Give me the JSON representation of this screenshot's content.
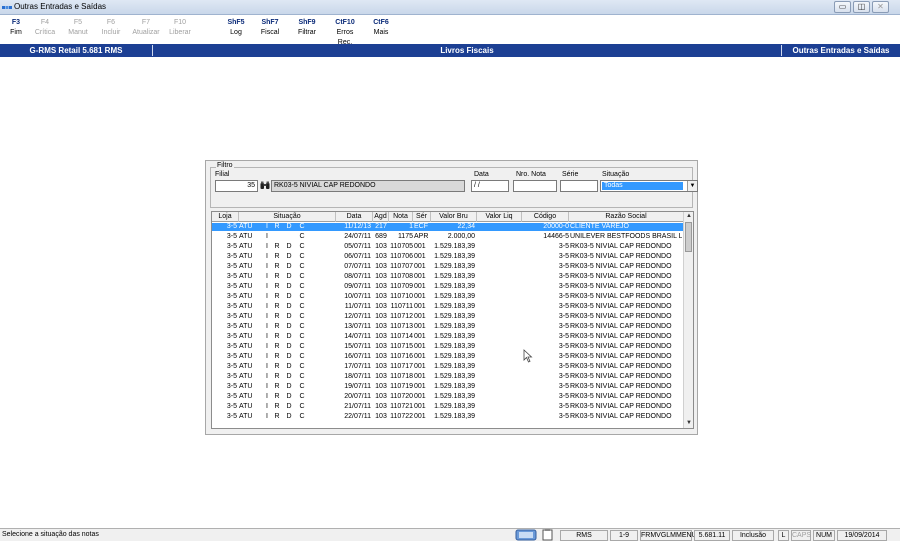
{
  "window": {
    "title": "Outras Entradas e Saídas",
    "buttons": [
      "▭",
      "◫",
      "✕"
    ]
  },
  "toolbar": {
    "keys": [
      {
        "key": "F3",
        "label": "Fim",
        "enabled": true
      },
      {
        "key": "F4",
        "label": "Crítica",
        "enabled": false
      },
      {
        "key": "F5",
        "label": "Manut",
        "enabled": false
      },
      {
        "key": "F6",
        "label": "Incluir",
        "enabled": false
      },
      {
        "key": "F7",
        "label": "Atualizar",
        "enabled": false
      },
      {
        "key": "F10",
        "label": "Liberar",
        "enabled": false
      },
      {
        "key": "ShF5",
        "label": "Log",
        "enabled": true
      },
      {
        "key": "ShF7",
        "label": "Fiscal",
        "enabled": true
      },
      {
        "key": "ShF9",
        "label": "Filtrar",
        "enabled": true
      },
      {
        "key": "CtF10",
        "label": "Erros Rec.",
        "enabled": true
      },
      {
        "key": "CtF6",
        "label": "Mais",
        "enabled": true
      }
    ]
  },
  "header": {
    "app": "G-RMS Retail 5.681 RMS",
    "center": "Livros Fiscais",
    "right": "Outras Entradas e Saídas",
    "color": "#1c3f93"
  },
  "filtro": {
    "legend": "Filtro",
    "filial_label": "Filial",
    "filial_value": "35",
    "filial_name": "RK03-5 NIVIAL CAP REDONDO",
    "data_label": "Data",
    "data_value": " / /",
    "nro_nota_label": "Nro. Nota",
    "nro_nota_value": "",
    "serie_label": "Série",
    "serie_value": "",
    "situacao_label": "Situação",
    "situacao_value": "Todas"
  },
  "grid": {
    "columns": [
      "Loja",
      "Situação",
      "Data",
      "Agd",
      "Nota",
      "Sér",
      "Valor Bru",
      "Valor Liq",
      "Código",
      "Razão Social"
    ],
    "rows": [
      [
        "3-5",
        "ATU",
        "I",
        "R",
        "D",
        "C",
        "11/12/13",
        "217",
        "1",
        "ECF",
        "22,34",
        "",
        "20000-0",
        "CLIENTE VAREJO"
      ],
      [
        "3-5",
        "ATU",
        "I",
        "",
        "",
        "C",
        "24/07/11",
        "689",
        "1175",
        "APR",
        "2.000,00",
        "",
        "14466-5",
        "UNILEVER BESTFOODS BRASIL LT"
      ],
      [
        "3-5",
        "ATU",
        "I",
        "R",
        "D",
        "C",
        "05/07/11",
        "103",
        "110705",
        "001",
        "1.529.183,39",
        "",
        "3-5",
        "RK03-5 NIVIAL CAP REDONDO"
      ],
      [
        "3-5",
        "ATU",
        "I",
        "R",
        "D",
        "C",
        "06/07/11",
        "103",
        "110706",
        "001",
        "1.529.183,39",
        "",
        "3-5",
        "RK03-5 NIVIAL CAP REDONDO"
      ],
      [
        "3-5",
        "ATU",
        "I",
        "R",
        "D",
        "C",
        "07/07/11",
        "103",
        "110707",
        "001",
        "1.529.183,39",
        "",
        "3-5",
        "RK03-5 NIVIAL CAP REDONDO"
      ],
      [
        "3-5",
        "ATU",
        "I",
        "R",
        "D",
        "C",
        "08/07/11",
        "103",
        "110708",
        "001",
        "1.529.183,39",
        "",
        "3-5",
        "RK03-5 NIVIAL CAP REDONDO"
      ],
      [
        "3-5",
        "ATU",
        "I",
        "R",
        "D",
        "C",
        "09/07/11",
        "103",
        "110709",
        "001",
        "1.529.183,39",
        "",
        "3-5",
        "RK03-5 NIVIAL CAP REDONDO"
      ],
      [
        "3-5",
        "ATU",
        "I",
        "R",
        "D",
        "C",
        "10/07/11",
        "103",
        "110710",
        "001",
        "1.529.183,39",
        "",
        "3-5",
        "RK03-5 NIVIAL CAP REDONDO"
      ],
      [
        "3-5",
        "ATU",
        "I",
        "R",
        "D",
        "C",
        "11/07/11",
        "103",
        "110711",
        "001",
        "1.529.183,39",
        "",
        "3-5",
        "RK03-5 NIVIAL CAP REDONDO"
      ],
      [
        "3-5",
        "ATU",
        "I",
        "R",
        "D",
        "C",
        "12/07/11",
        "103",
        "110712",
        "001",
        "1.529.183,39",
        "",
        "3-5",
        "RK03-5 NIVIAL CAP REDONDO"
      ],
      [
        "3-5",
        "ATU",
        "I",
        "R",
        "D",
        "C",
        "13/07/11",
        "103",
        "110713",
        "001",
        "1.529.183,39",
        "",
        "3-5",
        "RK03-5 NIVIAL CAP REDONDO"
      ],
      [
        "3-5",
        "ATU",
        "I",
        "R",
        "D",
        "C",
        "14/07/11",
        "103",
        "110714",
        "001",
        "1.529.183,39",
        "",
        "3-5",
        "RK03-5 NIVIAL CAP REDONDO"
      ],
      [
        "3-5",
        "ATU",
        "I",
        "R",
        "D",
        "C",
        "15/07/11",
        "103",
        "110715",
        "001",
        "1.529.183,39",
        "",
        "3-5",
        "RK03-5 NIVIAL CAP REDONDO"
      ],
      [
        "3-5",
        "ATU",
        "I",
        "R",
        "D",
        "C",
        "16/07/11",
        "103",
        "110716",
        "001",
        "1.529.183,39",
        "",
        "3-5",
        "RK03-5 NIVIAL CAP REDONDO"
      ],
      [
        "3-5",
        "ATU",
        "I",
        "R",
        "D",
        "C",
        "17/07/11",
        "103",
        "110717",
        "001",
        "1.529.183,39",
        "",
        "3-5",
        "RK03-5 NIVIAL CAP REDONDO"
      ],
      [
        "3-5",
        "ATU",
        "I",
        "R",
        "D",
        "C",
        "18/07/11",
        "103",
        "110718",
        "001",
        "1.529.183,39",
        "",
        "3-5",
        "RK03-5 NIVIAL CAP REDONDO"
      ],
      [
        "3-5",
        "ATU",
        "I",
        "R",
        "D",
        "C",
        "19/07/11",
        "103",
        "110719",
        "001",
        "1.529.183,39",
        "",
        "3-5",
        "RK03-5 NIVIAL CAP REDONDO"
      ],
      [
        "3-5",
        "ATU",
        "I",
        "R",
        "D",
        "C",
        "20/07/11",
        "103",
        "110720",
        "001",
        "1.529.183,39",
        "",
        "3-5",
        "RK03-5 NIVIAL CAP REDONDO"
      ],
      [
        "3-5",
        "ATU",
        "I",
        "R",
        "D",
        "C",
        "21/07/11",
        "103",
        "110721",
        "001",
        "1.529.183,39",
        "",
        "3-5",
        "RK03-5 NIVIAL CAP REDONDO"
      ],
      [
        "3-5",
        "ATU",
        "I",
        "R",
        "D",
        "C",
        "22/07/11",
        "103",
        "110722",
        "001",
        "1.529.183,39",
        "",
        "3-5",
        "RK03-5 NIVIAL CAP REDONDO"
      ]
    ],
    "selected_row": 0,
    "selection_color": "#3399ff"
  },
  "statusbar": {
    "message": "Selecione a situação das notas",
    "system": "RMS",
    "range": "1-9",
    "menu": "FRMVGLMMENU",
    "version": "5.681.11",
    "mode": "Inclusão",
    "l": "L",
    "caps": "CAPS",
    "num": "NUM",
    "date": "19/09/2014"
  }
}
